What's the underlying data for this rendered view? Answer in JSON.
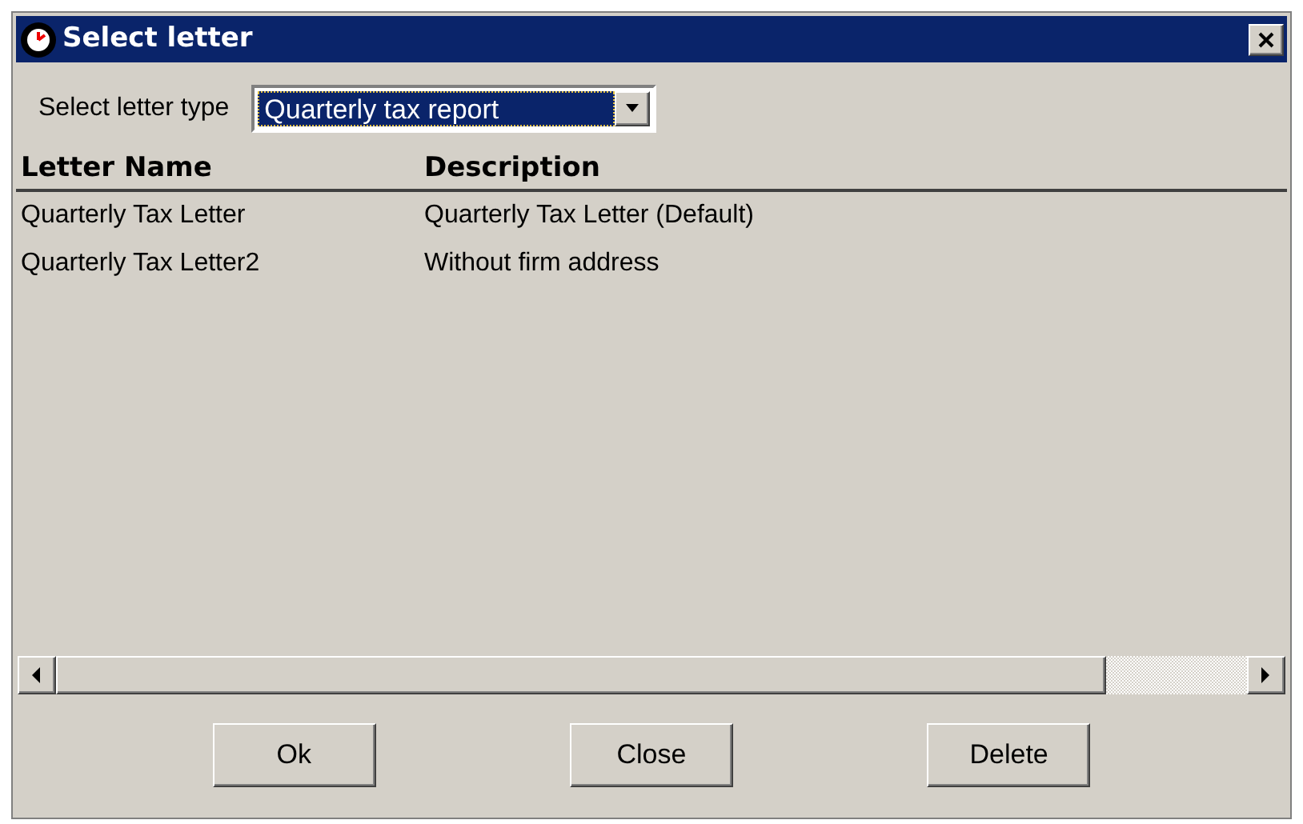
{
  "window": {
    "title": "Select letter"
  },
  "letter_type": {
    "label": "Select letter type",
    "value": "Quarterly tax report"
  },
  "table": {
    "columns": [
      "Letter Name",
      "Description"
    ],
    "rows": [
      [
        "Quarterly Tax Letter",
        "Quarterly Tax Letter (Default)"
      ],
      [
        "Quarterly Tax Letter2",
        "Without firm address"
      ]
    ]
  },
  "buttons": [
    "Ok",
    "Close",
    "Delete"
  ]
}
